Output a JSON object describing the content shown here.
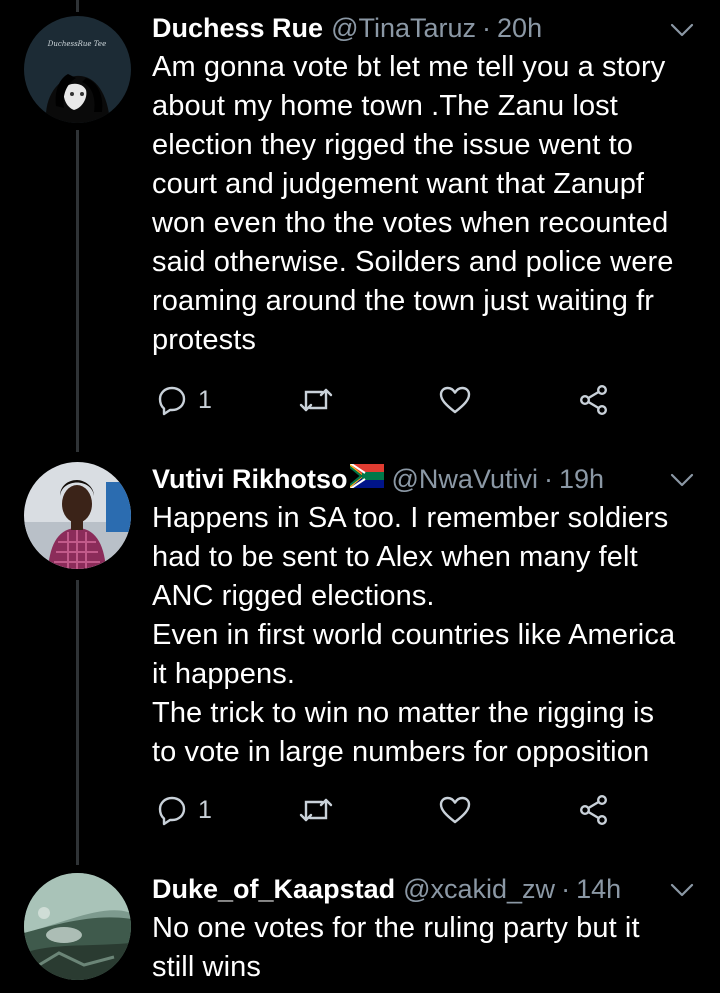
{
  "tweets": [
    {
      "name": "Duchess Rue",
      "handle": "@TinaTaruz",
      "time": "20h",
      "avatar_text": "DuchessRue Tee",
      "text": "Am gonna vote bt let me tell you a story\nabout my home town .The Zanu lost\nelection they rigged the issue went to\ncourt and judgement want that Zanupf\nwon even tho the votes when recounted\nsaid otherwise. Soilders and police were\nroaming around the town just waiting fr\nprotests",
      "reply_count": "1"
    },
    {
      "name": "Vutivi Rikhotso",
      "handle": "@NwaVutivi",
      "time": "19h",
      "text": "Happens in SA too. I remember soldiers\nhad to be sent to Alex when many felt\nANC rigged elections.\nEven in first world countries like America\nit happens.\nThe trick to win no matter the rigging is\nto vote in large numbers for opposition",
      "reply_count": "1"
    },
    {
      "name": "Duke_of_Kaapstad",
      "handle": "@xcakid_zw",
      "time": "14h",
      "text": "No one votes for the ruling party but it\nstill wins"
    }
  ],
  "separator": "·",
  "icons": {
    "reply": "reply-icon",
    "retweet": "retweet-icon",
    "like": "heart-icon",
    "share": "share-icon",
    "more": "chevron-down-icon"
  },
  "colors": {
    "background": "#000000",
    "text": "#ffffff",
    "secondary": "#8b98a5",
    "thread_line": "#2f3336",
    "icon": "#c9d1d9"
  }
}
